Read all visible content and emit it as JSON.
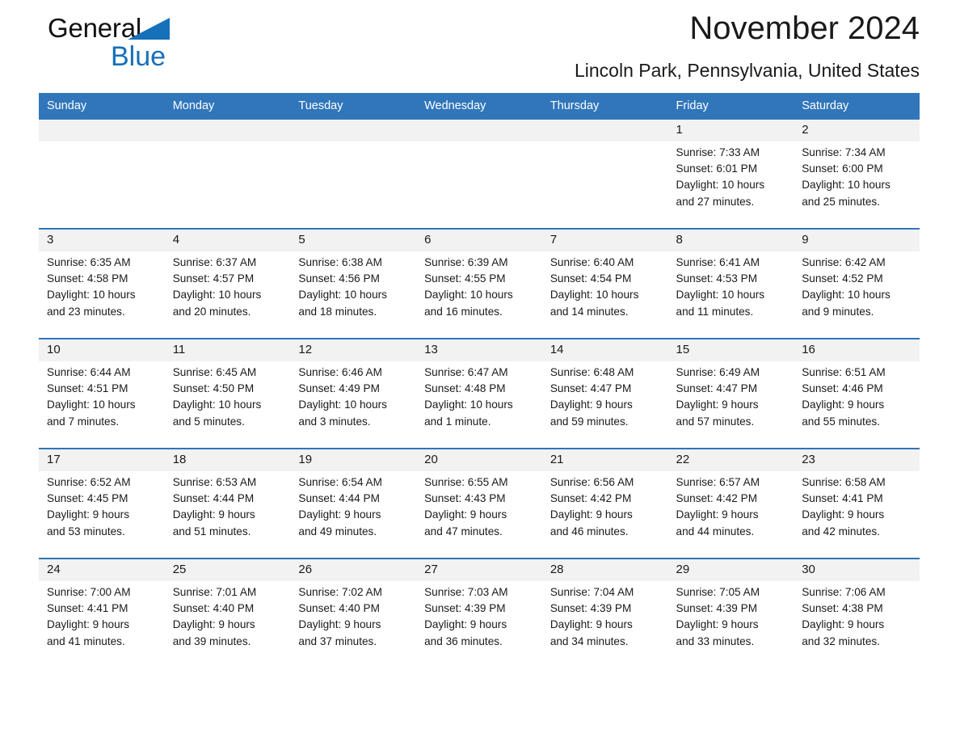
{
  "brand": {
    "name_part1": "General",
    "name_part2": "Blue",
    "triangle_color": "#1670ba",
    "accent_color": "#3176ba"
  },
  "header": {
    "title": "November 2024",
    "subtitle": "Lincoln Park, Pennsylvania, United States"
  },
  "calendar": {
    "weekday_headers": [
      "Sunday",
      "Monday",
      "Tuesday",
      "Wednesday",
      "Thursday",
      "Friday",
      "Saturday"
    ],
    "labels": {
      "sunrise": "Sunrise:",
      "sunset": "Sunset:",
      "daylight": "Daylight:"
    },
    "weeks": [
      [
        {
          "day": "",
          "lines": []
        },
        {
          "day": "",
          "lines": []
        },
        {
          "day": "",
          "lines": []
        },
        {
          "day": "",
          "lines": []
        },
        {
          "day": "",
          "lines": []
        },
        {
          "day": "1",
          "lines": [
            "Sunrise: 7:33 AM",
            "Sunset: 6:01 PM",
            "Daylight: 10 hours",
            "and 27 minutes."
          ]
        },
        {
          "day": "2",
          "lines": [
            "Sunrise: 7:34 AM",
            "Sunset: 6:00 PM",
            "Daylight: 10 hours",
            "and 25 minutes."
          ]
        }
      ],
      [
        {
          "day": "3",
          "lines": [
            "Sunrise: 6:35 AM",
            "Sunset: 4:58 PM",
            "Daylight: 10 hours",
            "and 23 minutes."
          ]
        },
        {
          "day": "4",
          "lines": [
            "Sunrise: 6:37 AM",
            "Sunset: 4:57 PM",
            "Daylight: 10 hours",
            "and 20 minutes."
          ]
        },
        {
          "day": "5",
          "lines": [
            "Sunrise: 6:38 AM",
            "Sunset: 4:56 PM",
            "Daylight: 10 hours",
            "and 18 minutes."
          ]
        },
        {
          "day": "6",
          "lines": [
            "Sunrise: 6:39 AM",
            "Sunset: 4:55 PM",
            "Daylight: 10 hours",
            "and 16 minutes."
          ]
        },
        {
          "day": "7",
          "lines": [
            "Sunrise: 6:40 AM",
            "Sunset: 4:54 PM",
            "Daylight: 10 hours",
            "and 14 minutes."
          ]
        },
        {
          "day": "8",
          "lines": [
            "Sunrise: 6:41 AM",
            "Sunset: 4:53 PM",
            "Daylight: 10 hours",
            "and 11 minutes."
          ]
        },
        {
          "day": "9",
          "lines": [
            "Sunrise: 6:42 AM",
            "Sunset: 4:52 PM",
            "Daylight: 10 hours",
            "and 9 minutes."
          ]
        }
      ],
      [
        {
          "day": "10",
          "lines": [
            "Sunrise: 6:44 AM",
            "Sunset: 4:51 PM",
            "Daylight: 10 hours",
            "and 7 minutes."
          ]
        },
        {
          "day": "11",
          "lines": [
            "Sunrise: 6:45 AM",
            "Sunset: 4:50 PM",
            "Daylight: 10 hours",
            "and 5 minutes."
          ]
        },
        {
          "day": "12",
          "lines": [
            "Sunrise: 6:46 AM",
            "Sunset: 4:49 PM",
            "Daylight: 10 hours",
            "and 3 minutes."
          ]
        },
        {
          "day": "13",
          "lines": [
            "Sunrise: 6:47 AM",
            "Sunset: 4:48 PM",
            "Daylight: 10 hours",
            "and 1 minute."
          ]
        },
        {
          "day": "14",
          "lines": [
            "Sunrise: 6:48 AM",
            "Sunset: 4:47 PM",
            "Daylight: 9 hours",
            "and 59 minutes."
          ]
        },
        {
          "day": "15",
          "lines": [
            "Sunrise: 6:49 AM",
            "Sunset: 4:47 PM",
            "Daylight: 9 hours",
            "and 57 minutes."
          ]
        },
        {
          "day": "16",
          "lines": [
            "Sunrise: 6:51 AM",
            "Sunset: 4:46 PM",
            "Daylight: 9 hours",
            "and 55 minutes."
          ]
        }
      ],
      [
        {
          "day": "17",
          "lines": [
            "Sunrise: 6:52 AM",
            "Sunset: 4:45 PM",
            "Daylight: 9 hours",
            "and 53 minutes."
          ]
        },
        {
          "day": "18",
          "lines": [
            "Sunrise: 6:53 AM",
            "Sunset: 4:44 PM",
            "Daylight: 9 hours",
            "and 51 minutes."
          ]
        },
        {
          "day": "19",
          "lines": [
            "Sunrise: 6:54 AM",
            "Sunset: 4:44 PM",
            "Daylight: 9 hours",
            "and 49 minutes."
          ]
        },
        {
          "day": "20",
          "lines": [
            "Sunrise: 6:55 AM",
            "Sunset: 4:43 PM",
            "Daylight: 9 hours",
            "and 47 minutes."
          ]
        },
        {
          "day": "21",
          "lines": [
            "Sunrise: 6:56 AM",
            "Sunset: 4:42 PM",
            "Daylight: 9 hours",
            "and 46 minutes."
          ]
        },
        {
          "day": "22",
          "lines": [
            "Sunrise: 6:57 AM",
            "Sunset: 4:42 PM",
            "Daylight: 9 hours",
            "and 44 minutes."
          ]
        },
        {
          "day": "23",
          "lines": [
            "Sunrise: 6:58 AM",
            "Sunset: 4:41 PM",
            "Daylight: 9 hours",
            "and 42 minutes."
          ]
        }
      ],
      [
        {
          "day": "24",
          "lines": [
            "Sunrise: 7:00 AM",
            "Sunset: 4:41 PM",
            "Daylight: 9 hours",
            "and 41 minutes."
          ]
        },
        {
          "day": "25",
          "lines": [
            "Sunrise: 7:01 AM",
            "Sunset: 4:40 PM",
            "Daylight: 9 hours",
            "and 39 minutes."
          ]
        },
        {
          "day": "26",
          "lines": [
            "Sunrise: 7:02 AM",
            "Sunset: 4:40 PM",
            "Daylight: 9 hours",
            "and 37 minutes."
          ]
        },
        {
          "day": "27",
          "lines": [
            "Sunrise: 7:03 AM",
            "Sunset: 4:39 PM",
            "Daylight: 9 hours",
            "and 36 minutes."
          ]
        },
        {
          "day": "28",
          "lines": [
            "Sunrise: 7:04 AM",
            "Sunset: 4:39 PM",
            "Daylight: 9 hours",
            "and 34 minutes."
          ]
        },
        {
          "day": "29",
          "lines": [
            "Sunrise: 7:05 AM",
            "Sunset: 4:39 PM",
            "Daylight: 9 hours",
            "and 33 minutes."
          ]
        },
        {
          "day": "30",
          "lines": [
            "Sunrise: 7:06 AM",
            "Sunset: 4:38 PM",
            "Daylight: 9 hours",
            "and 32 minutes."
          ]
        }
      ]
    ]
  }
}
